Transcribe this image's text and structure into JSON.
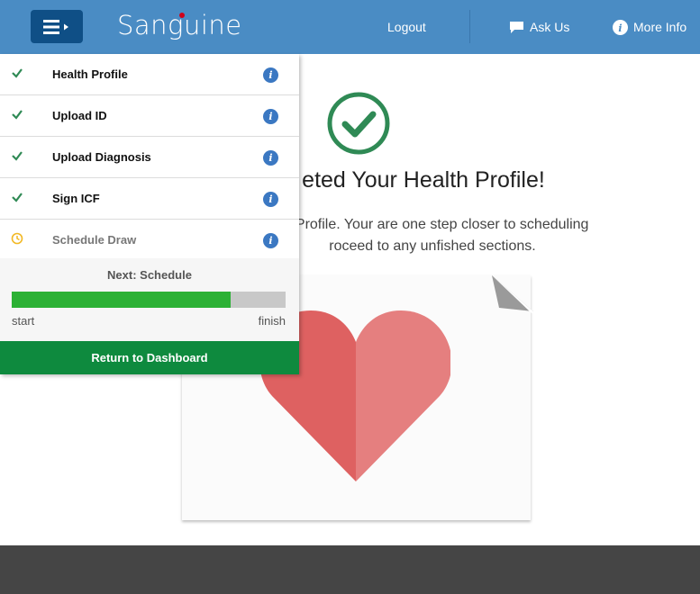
{
  "header": {
    "logo_text": "Sanguine",
    "logout_label": "Logout",
    "ask_us_label": "Ask Us",
    "more_info_label": "More Info",
    "bg_color": "#4a8cc4",
    "menu_button_color": "#0f4f86"
  },
  "main": {
    "title": "eted Your Health Profile!",
    "text_line1": "lth Profile. Your are one step closer to scheduling",
    "text_line2": "roceed to any unfished sections.",
    "check_color": "#2f8a55",
    "heart_colors": [
      "#de6161",
      "#e57f7f"
    ]
  },
  "menu": {
    "items": [
      {
        "label": "Health Profile",
        "status": "complete",
        "status_icon": "check-icon"
      },
      {
        "label": "Upload ID",
        "status": "complete",
        "status_icon": "check-icon"
      },
      {
        "label": "Upload Diagnosis",
        "status": "complete",
        "status_icon": "check-icon"
      },
      {
        "label": "Sign ICF",
        "status": "complete",
        "status_icon": "check-icon"
      },
      {
        "label": "Schedule Draw",
        "status": "pending",
        "status_icon": "clock-icon"
      }
    ],
    "info_icon": "info-icon",
    "next_label": "Next: Schedule",
    "progress_fraction": 0.8,
    "progress_start_label": "start",
    "progress_finish_label": "finish",
    "progress_color": "#2cb135",
    "dashboard_button_label": "Return to Dashboard",
    "dashboard_button_color": "#0e8a3e"
  },
  "footer": {
    "bg_color": "#454545"
  }
}
